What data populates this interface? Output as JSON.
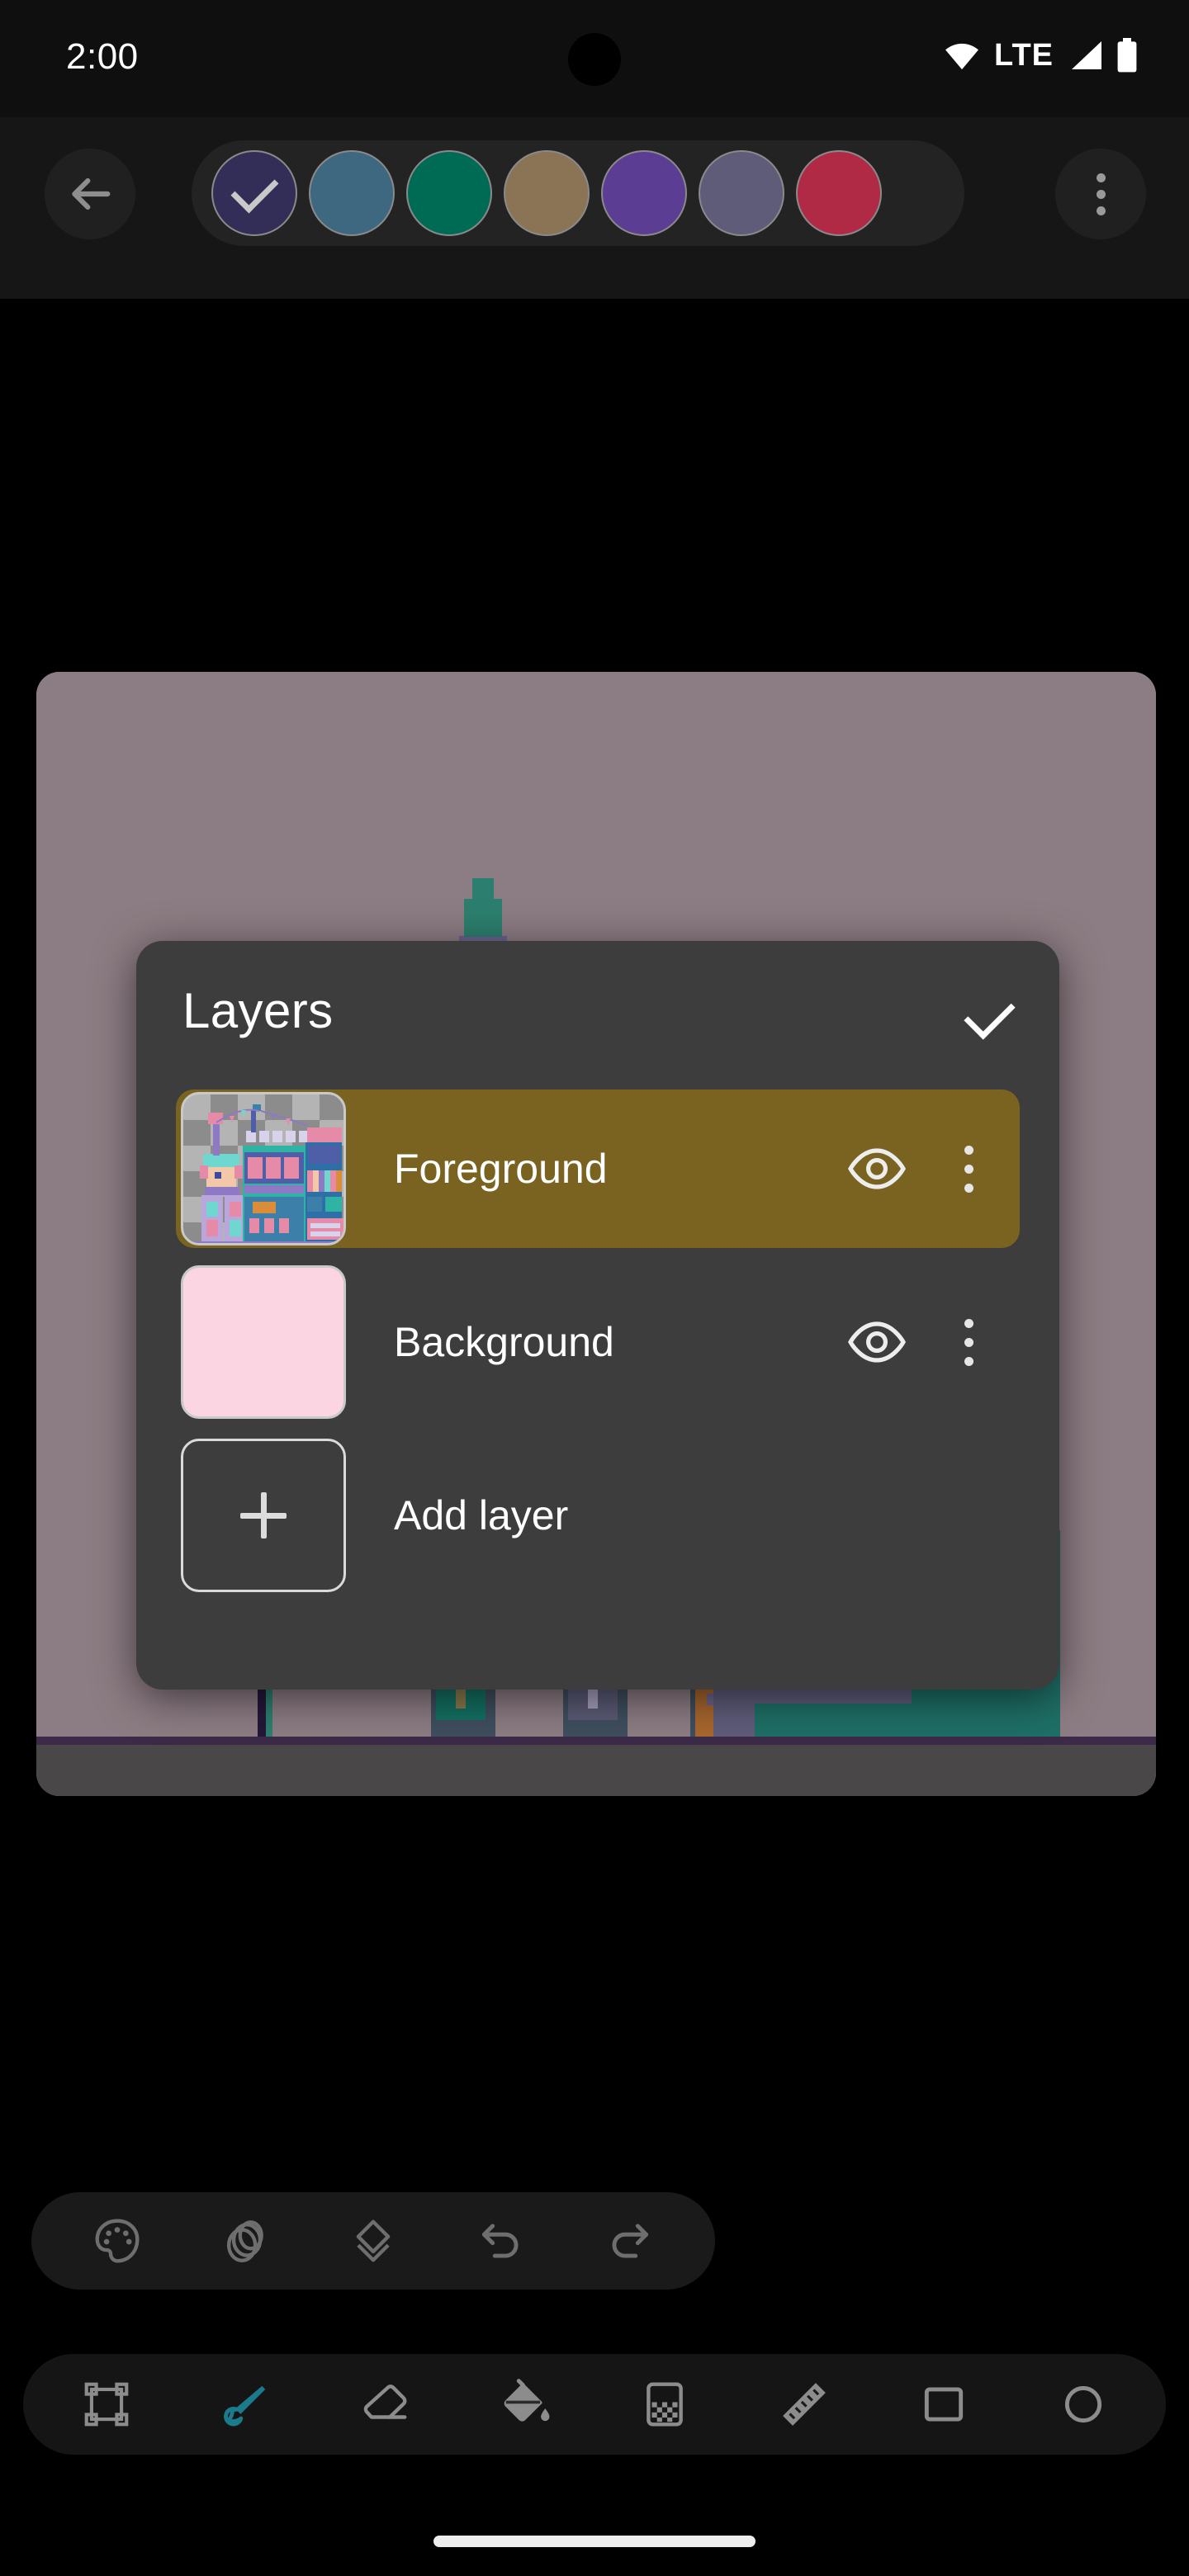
{
  "status_bar": {
    "time": "2:00",
    "network_label": "LTE",
    "icons": [
      "wifi-icon",
      "signal-icon",
      "battery-icon"
    ]
  },
  "top_bar": {
    "back_icon": "back-arrow-icon",
    "overflow_icon": "more-vertical-icon",
    "palette": {
      "selected_index": 0,
      "swatches": [
        {
          "name": "swatch-dark-navy",
          "color": "#332E57",
          "selected": true
        },
        {
          "name": "swatch-steel-blue",
          "color": "#3D6880",
          "selected": false
        },
        {
          "name": "swatch-teal-green",
          "color": "#006B55",
          "selected": false
        },
        {
          "name": "swatch-tan",
          "color": "#8B7355",
          "selected": false
        },
        {
          "name": "swatch-purple",
          "color": "#5B3E93",
          "selected": false
        },
        {
          "name": "swatch-slate-purple",
          "color": "#5F5C7A",
          "selected": false
        },
        {
          "name": "swatch-crimson",
          "color": "#B02A45",
          "selected": false
        }
      ]
    }
  },
  "canvas": {
    "background_color": "#8C7C83",
    "ground_color": "#4A4748",
    "artwork_description": "pixel art street scene with lamp posts, bunting flags and shop buildings"
  },
  "dialog": {
    "title": "Layers",
    "confirm_icon": "check-icon",
    "layers": [
      {
        "name": "Foreground",
        "selected": true,
        "thumbnail": "pixel-art-juice-shop-thumbnail",
        "visibility_icon": "eye-icon",
        "visible": true,
        "menu_icon": "more-vertical-icon",
        "highlight_color": "#7A6321"
      },
      {
        "name": "Background",
        "selected": false,
        "thumbnail": "solid-pink-thumbnail",
        "thumbnail_color": "#FBD6E2",
        "visibility_icon": "eye-icon",
        "visible": true,
        "menu_icon": "more-vertical-icon"
      }
    ],
    "add_layer": {
      "label": "Add layer",
      "icon": "plus-icon"
    }
  },
  "toolbar_secondary": {
    "items": [
      {
        "name": "palette-tool",
        "icon": "palette-icon",
        "active": false
      },
      {
        "name": "frames-tool",
        "icon": "frames-icon",
        "active": false
      },
      {
        "name": "layers-tool",
        "icon": "layers-icon",
        "active": false
      },
      {
        "name": "undo-tool",
        "icon": "undo-icon",
        "active": false
      },
      {
        "name": "redo-tool",
        "icon": "redo-icon",
        "active": false
      }
    ]
  },
  "toolbar_main": {
    "active_color": "#1B7A8C",
    "items": [
      {
        "name": "select-tool",
        "icon": "selection-frame-icon",
        "active": false
      },
      {
        "name": "brush-tool",
        "icon": "brush-icon",
        "active": true
      },
      {
        "name": "eraser-tool",
        "icon": "eraser-icon",
        "active": false
      },
      {
        "name": "fill-tool",
        "icon": "paint-bucket-icon",
        "active": false
      },
      {
        "name": "dither-tool",
        "icon": "dither-icon",
        "active": false
      },
      {
        "name": "line-tool",
        "icon": "ruler-icon",
        "active": false
      },
      {
        "name": "rectangle-tool",
        "icon": "rectangle-icon",
        "active": false
      },
      {
        "name": "ellipse-tool",
        "icon": "ellipse-icon",
        "active": false
      }
    ]
  },
  "navigation_bar": {
    "gesture_pill": "home-indicator"
  }
}
